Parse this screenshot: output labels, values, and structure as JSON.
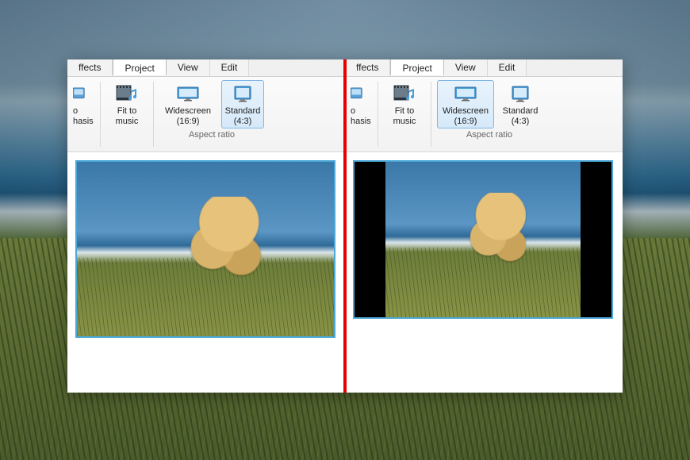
{
  "tabs": {
    "effects": "Effects",
    "project": "Project",
    "view": "View",
    "edit": "Edit",
    "effects_partial": "ffects"
  },
  "ribbon": {
    "emphasis_partial_line1": "o",
    "emphasis_partial_line2": "hasis",
    "fit_to": "Fit to",
    "music": "music",
    "widescreen": "Widescreen",
    "widescreen_ratio": "(16:9)",
    "standard": "Standard",
    "standard_ratio": "(4:3)",
    "aspect_group": "Aspect ratio"
  },
  "panes": {
    "left": {
      "selected": "standard"
    },
    "right": {
      "selected": "widescreen"
    }
  }
}
